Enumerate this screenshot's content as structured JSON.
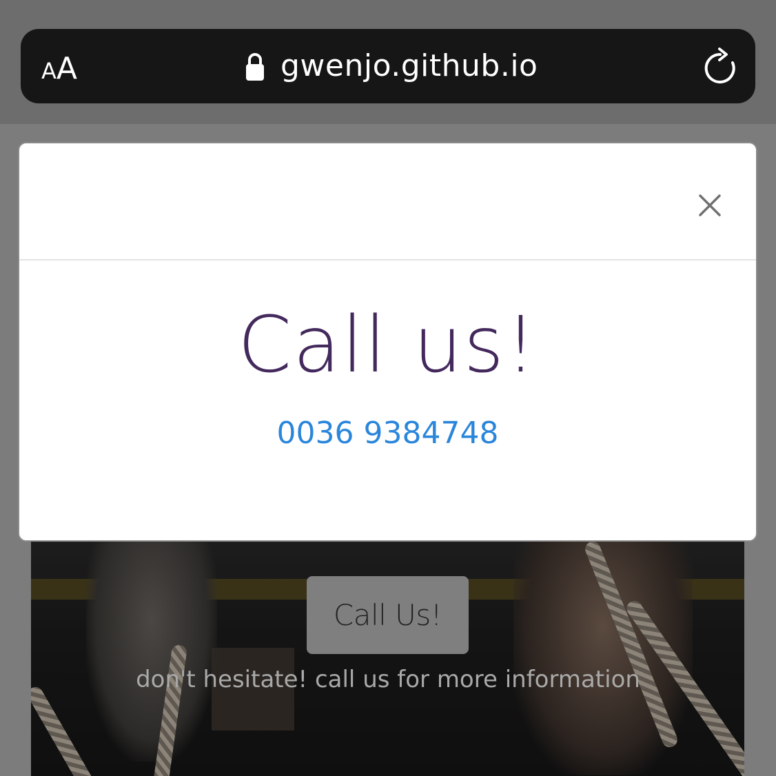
{
  "browser": {
    "text_size_small": "A",
    "text_size_big": "A",
    "url": "gwenjo.github.io",
    "icons": [
      "lock-icon",
      "reload-icon"
    ]
  },
  "modal": {
    "title": "Call us!",
    "phone": "0036 9384748",
    "close_icon": "close-icon",
    "colors": {
      "title": "#43295c",
      "phone": "#2a86db"
    }
  },
  "hero": {
    "button_label": "Call Us!",
    "tagline": "don't hesitate! call us for more information"
  }
}
